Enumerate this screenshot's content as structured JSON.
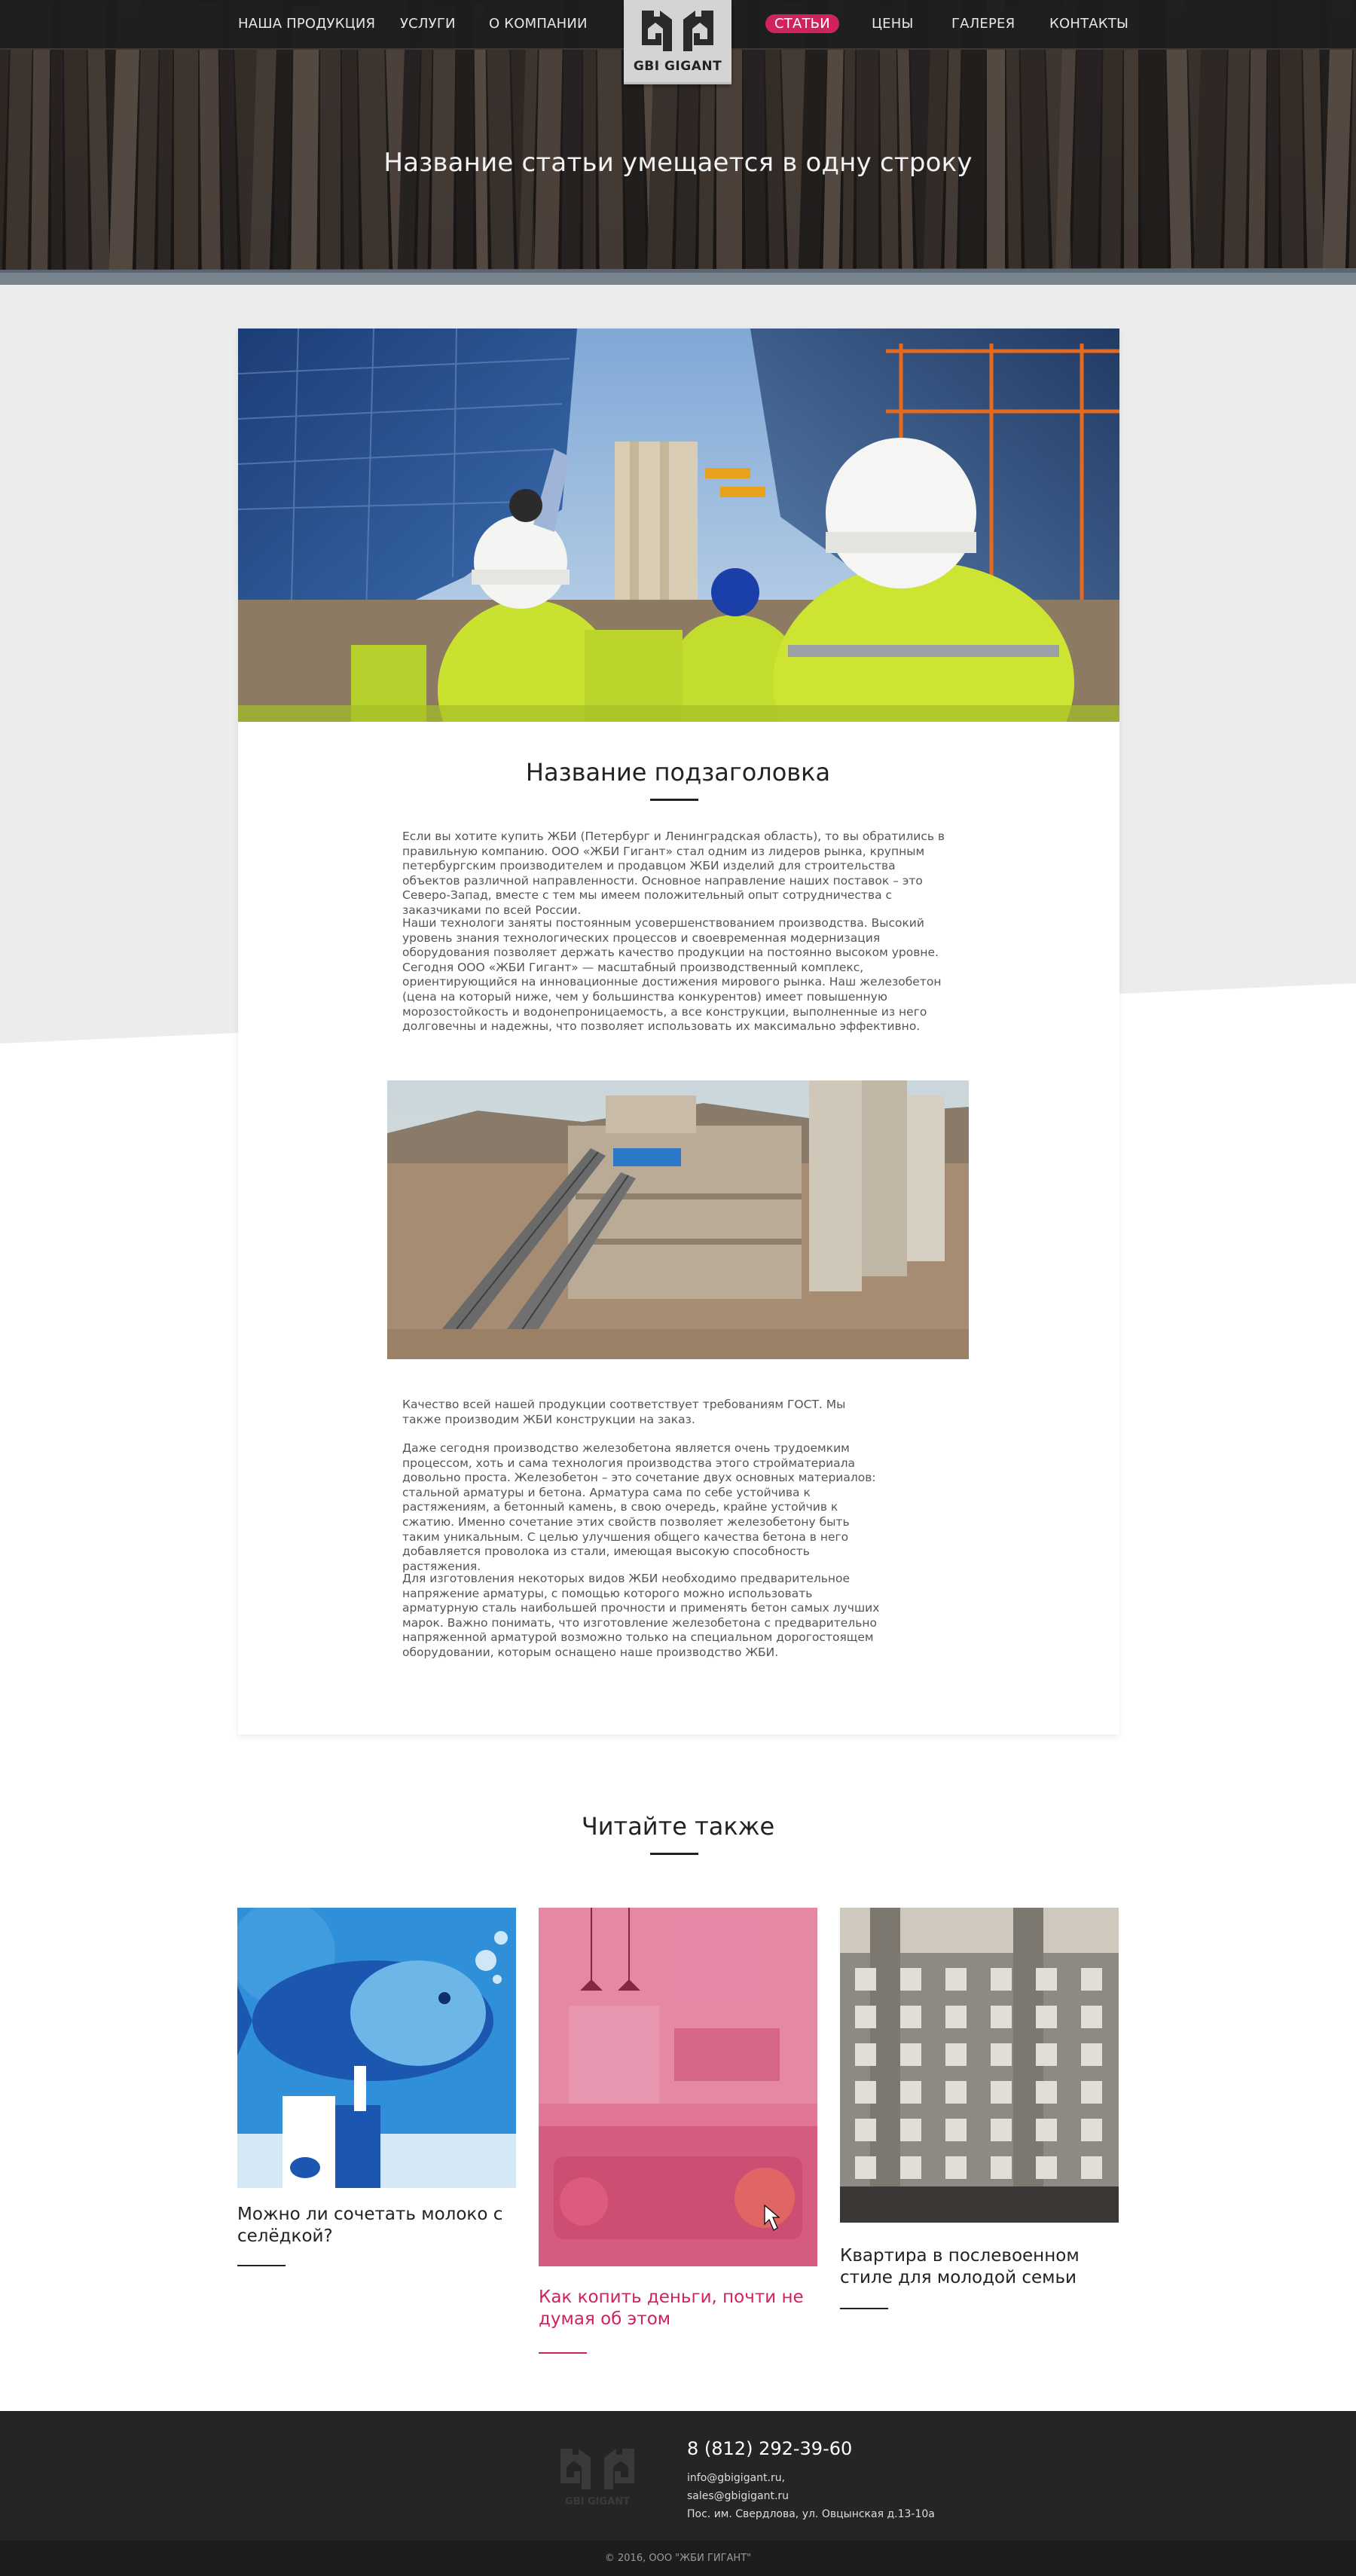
{
  "nav": {
    "items": [
      "НАША ПРОДУКЦИЯ",
      "УСЛУГИ",
      "О КОМПАНИИ",
      "СТАТЬИ",
      "ЦЕНЫ",
      "ГАЛЕРЕЯ",
      "КОНТАКТЫ"
    ],
    "active": "СТАТЬИ",
    "logo_text": "GBI GIGANT"
  },
  "hero": {
    "title": "Название статьи умещается в одну строку"
  },
  "article": {
    "subtitle": "Название подзаголовка",
    "p1": "Если вы хотите купить ЖБИ (Петербург и Ленинградская область), то вы обратились в правильную компанию. ООО «ЖБИ Гигант» стал одним из лидеров рынка, крупным петербургским производителем и продавцом ЖБИ изделий для строительства объектов различной направленности. Основное направление наших поставок – это Северо-Запад, вместе с тем мы имеем положительный опыт сотрудничества с заказчиками по всей России.",
    "p2": "Наши технологи заняты постоянным усовершенствованием производства. Высокий уровень знания технологических процессов и своевременная модернизация оборудования позволяет держать качество продукции на постоянно высоком уровне. Сегодня ООО «ЖБИ Гигант» — масштабный производственный комплекс, ориентирующийся на инновационные достижения мирового рынка. Наш железобетон (цена на который ниже, чем у большинства конкурентов) имеет повышенную морозостойкость и водонепроницаемость, а все конструкции, выполненные из него долговечны и надежны, что позволяет использовать их максимально эффективно.",
    "p3": "Качество всей нашей продукции соответствует требованиям ГОСТ. Мы также производим ЖБИ конструкции на заказ.",
    "p4": "Даже сегодня производство железобетона является очень трудоемким процессом, хоть и сама технология производства этого стройматериала довольно проста. Железобетон – это сочетание двух основных материалов: стальной арматуры и бетона. Арматура сама по себе устойчива к растяжениям, а бетонный камень, в свою очередь, крайне устойчив к сжатию. Именно сочетание этих свойств позволяет железобетону быть таким уникальным. С целью улучшения общего качества бетона в него добавляется проволока из стали, имеющая высокую способность растяжения.",
    "p5": "Для изготовления некоторых видов ЖБИ необходимо предварительное напряжение арматуры, с помощью которого можно использовать арматурную сталь наибольшей прочности и применять бетон самых лучших марок. Важно  понимать, что изготовление железобетона с предварительно напряженной арматурой возможно только на специальном дорогостоящем оборудовании, которым оснащено наше производство ЖБИ."
  },
  "read_also": {
    "title": "Читайте также",
    "items": [
      {
        "caption_l1": "Можно ли сочетать молоко с",
        "caption_l2": "селёдкой?"
      },
      {
        "caption_l1": "Как копить деньги, почти не",
        "caption_l2": "думая об этом"
      },
      {
        "caption_l1": "Квартира в послевоенном",
        "caption_l2": "стиле для молодой семьи"
      }
    ]
  },
  "footer": {
    "logo_text": "GBI GIGANT",
    "phone": "8 (812) 292-39-60",
    "email1": "info@gbigigant.ru,",
    "email2": "sales@gbigigant.ru",
    "address": "Пос. им. Свердлова, ул. Овцынская д.13-10а",
    "copyright": "© 2016, ООО \"ЖБИ ГИГАНТ\""
  },
  "colors": {
    "accent": "#d0225f",
    "dark": "#252525",
    "gray": "#ececec"
  }
}
